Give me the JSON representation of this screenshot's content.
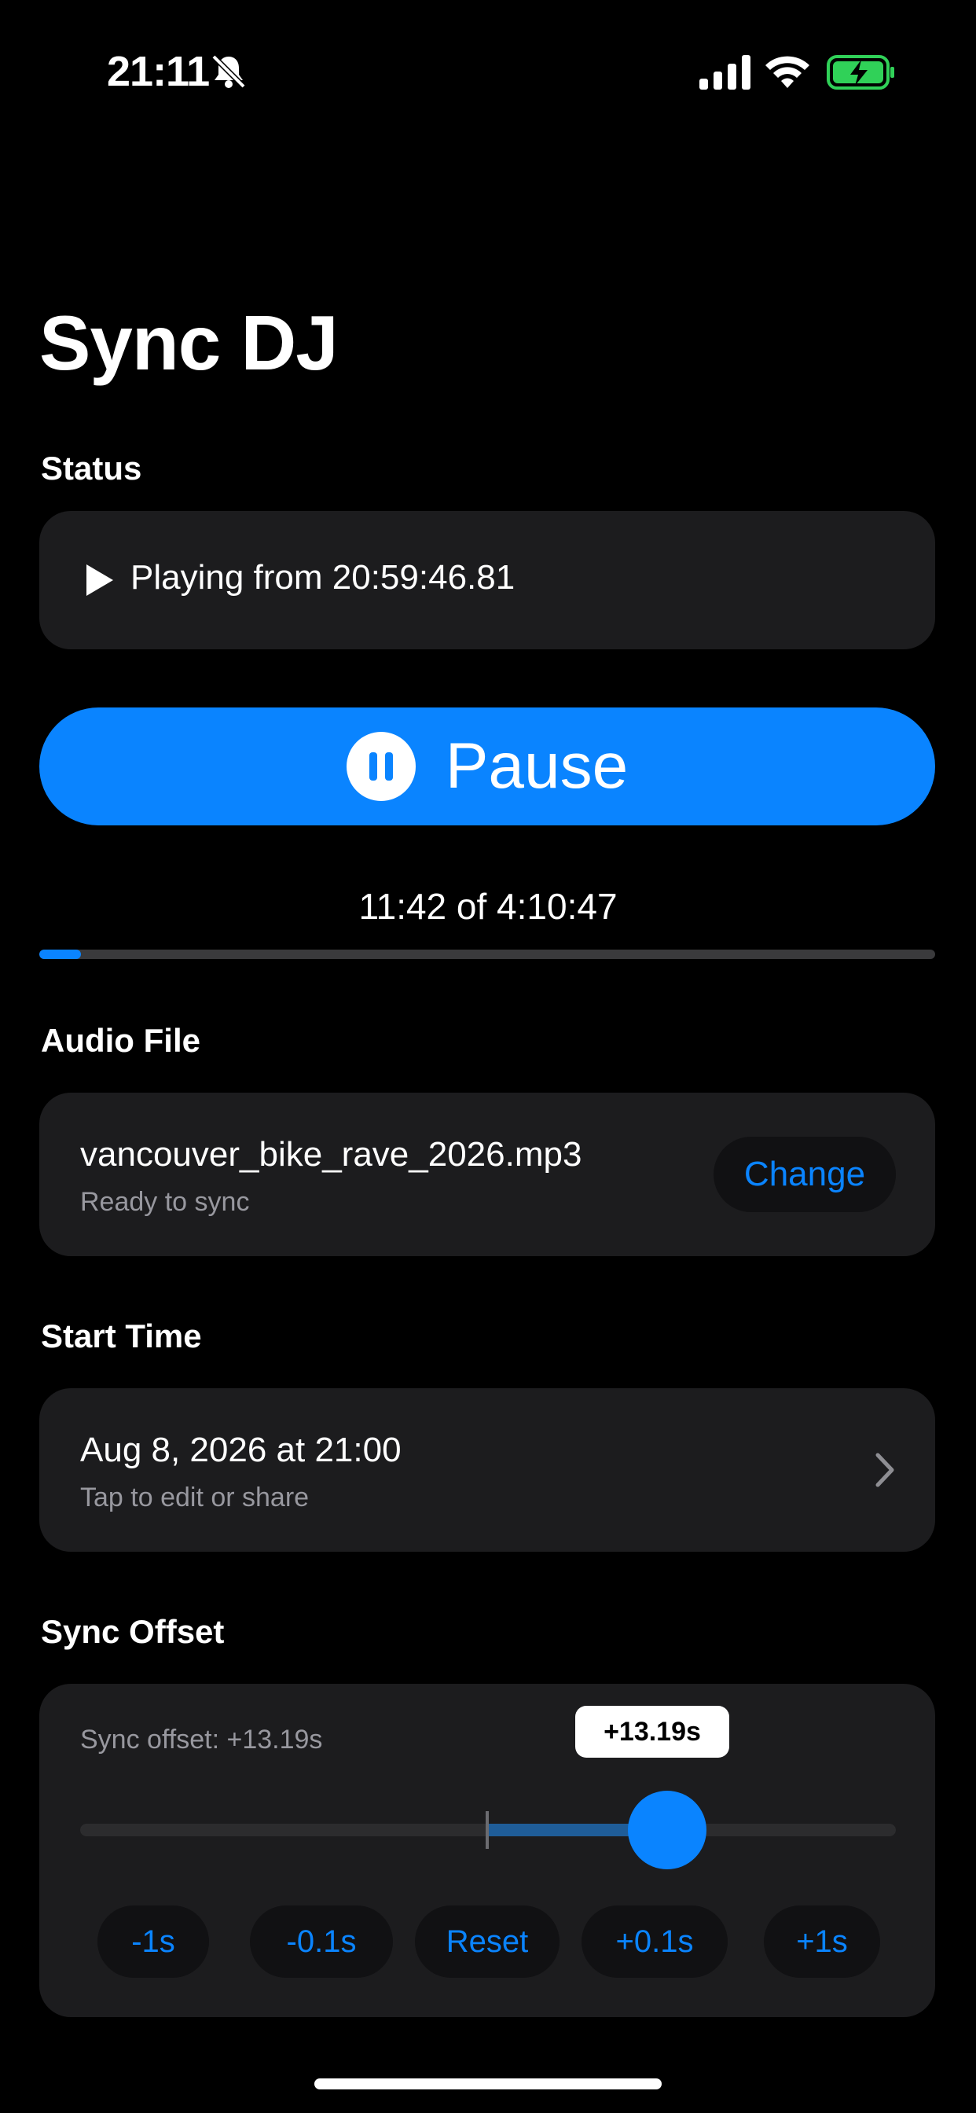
{
  "status_bar": {
    "time": "21:11",
    "icons": [
      "bell-slash-icon",
      "cellular-signal-icon",
      "wifi-icon",
      "battery-charging-icon"
    ],
    "battery_color": "#30d158"
  },
  "app": {
    "title": "Sync DJ",
    "accent_color": "#0a84ff"
  },
  "status_section": {
    "label": "Status",
    "icon": "play-icon",
    "text": "Playing from 20:59:46.81"
  },
  "pause_button": {
    "icon": "pause-circle-icon",
    "label": "Pause"
  },
  "progress": {
    "text": "11:42 of 4:10:47",
    "fraction": 0.0467
  },
  "audio_section": {
    "label": "Audio File",
    "file_name": "vancouver_bike_rave_2026.mp3",
    "subtitle": "Ready to sync",
    "change_label": "Change"
  },
  "start_section": {
    "label": "Start Time",
    "value": "Aug 8, 2026 at 21:00",
    "subtitle": "Tap to edit or share",
    "icon": "chevron-right-icon"
  },
  "offset_section": {
    "label": "Sync Offset",
    "text": "Sync offset: +13.19s",
    "tooltip": "+13.19s",
    "value_seconds": 13.19,
    "range_seconds": [
      -30,
      30
    ],
    "buttons": [
      "-1s",
      "-0.1s",
      "Reset",
      "+0.1s",
      "+1s"
    ]
  }
}
